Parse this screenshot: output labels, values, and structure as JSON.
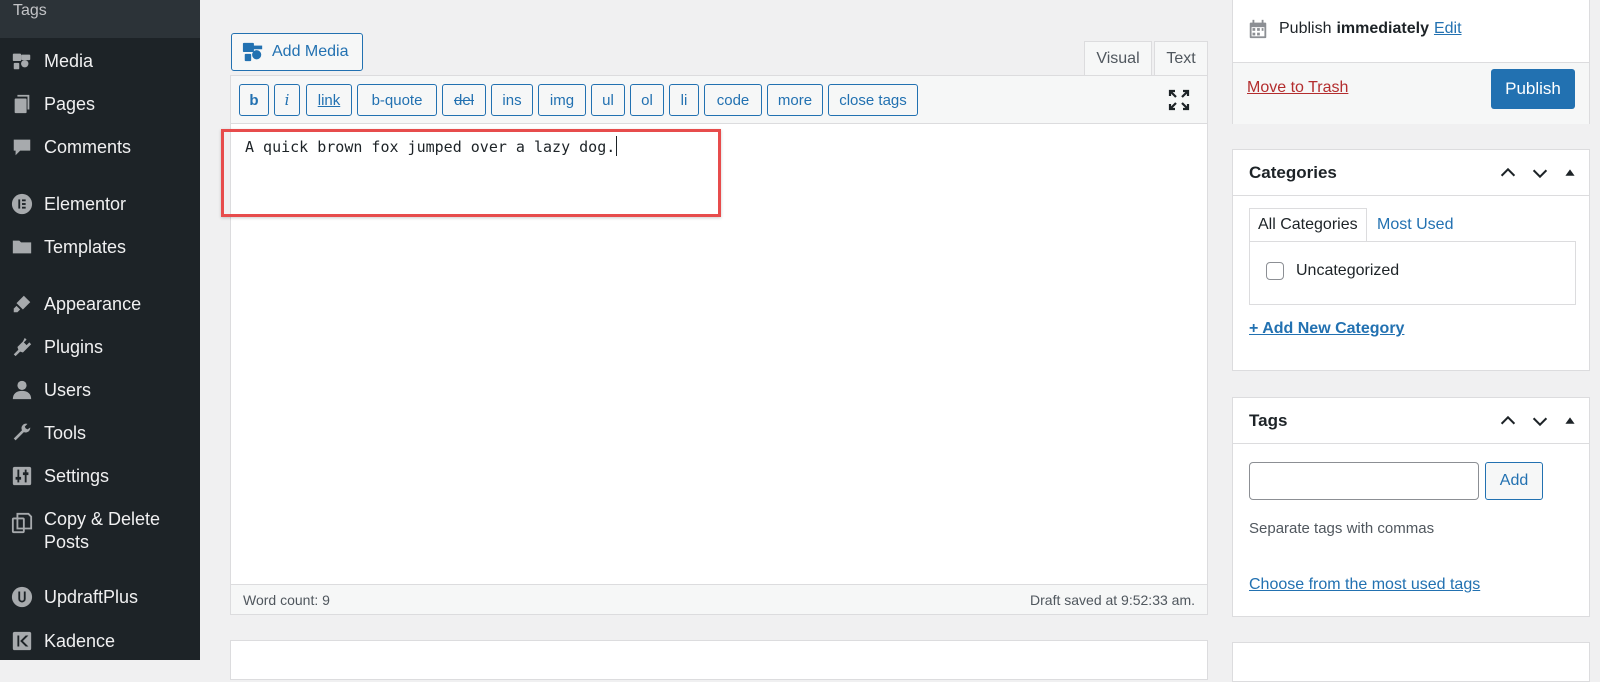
{
  "sidebar": {
    "top_label": "Tags",
    "items": [
      {
        "label": "Media",
        "icon": "media-icon"
      },
      {
        "label": "Pages",
        "icon": "pages-icon"
      },
      {
        "label": "Comments",
        "icon": "comments-icon"
      },
      {
        "label": "Elementor",
        "icon": "elementor-icon"
      },
      {
        "label": "Templates",
        "icon": "folder-icon"
      },
      {
        "label": "Appearance",
        "icon": "brush-icon"
      },
      {
        "label": "Plugins",
        "icon": "plugin-icon"
      },
      {
        "label": "Users",
        "icon": "user-icon"
      },
      {
        "label": "Tools",
        "icon": "wrench-icon"
      },
      {
        "label": "Settings",
        "icon": "settings-sliders-icon"
      },
      {
        "label": "Copy & Delete\nPosts",
        "line1": "Copy & Delete",
        "line2": "Posts",
        "icon": "copy-icon"
      },
      {
        "label": "UpdraftPlus",
        "icon": "updraft-icon"
      },
      {
        "label": "Kadence",
        "icon": "kadence-icon"
      }
    ]
  },
  "editor": {
    "add_media_label": "Add Media",
    "tabs": {
      "visual": "Visual",
      "text": "Text"
    },
    "quicktags": [
      "b",
      "i",
      "link",
      "b-quote",
      "del",
      "ins",
      "img",
      "ul",
      "ol",
      "li",
      "code",
      "more",
      "close tags"
    ],
    "content": "A quick brown fox jumped over a lazy dog.",
    "word_count": "Word count: 9",
    "draft_saved": "Draft saved at 9:52:33 am."
  },
  "publish": {
    "label": "Publish",
    "when": "immediately",
    "edit_link": "Edit",
    "trash_link": "Move to Trash",
    "publish_button": "Publish"
  },
  "categories": {
    "title": "Categories",
    "tab_all": "All Categories",
    "tab_most_used": "Most Used",
    "items": [
      {
        "label": "Uncategorized",
        "checked": false
      }
    ],
    "add_new": "+ Add New Category"
  },
  "tags": {
    "title": "Tags",
    "input_value": "",
    "add_button": "Add",
    "hint": "Separate tags with commas",
    "most_used_link": "Choose from the most used tags"
  },
  "colors": {
    "sidebar_bg": "#1d2327",
    "accent": "#2271b1",
    "highlight": "#e74c4c",
    "trash": "#b32d2e"
  }
}
